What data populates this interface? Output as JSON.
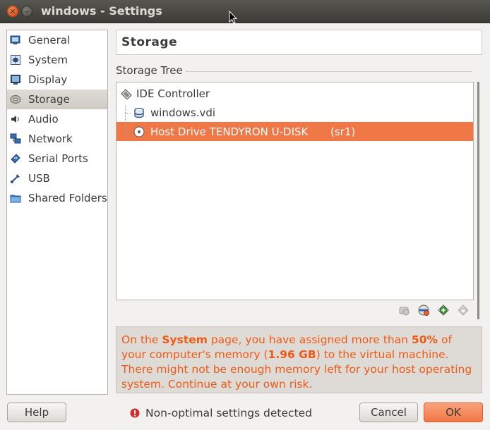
{
  "window": {
    "title": "windows - Settings"
  },
  "sidebar": {
    "items": [
      {
        "label": "General",
        "icon": "monitor-icon"
      },
      {
        "label": "System",
        "icon": "chip-icon"
      },
      {
        "label": "Display",
        "icon": "display-icon"
      },
      {
        "label": "Storage",
        "icon": "disk-icon",
        "active": true
      },
      {
        "label": "Audio",
        "icon": "speaker-icon"
      },
      {
        "label": "Network",
        "icon": "network-icon"
      },
      {
        "label": "Serial Ports",
        "icon": "serial-port-icon"
      },
      {
        "label": "USB",
        "icon": "usb-icon"
      },
      {
        "label": "Shared Folders",
        "icon": "folder-icon"
      }
    ]
  },
  "main": {
    "header": "Storage",
    "section_label": "Storage Tree",
    "tree": {
      "controller": "IDE Controller",
      "disk": "windows.vdi",
      "drive": "Host Drive TENDYRON U-DISK",
      "drive_slot": "(sr1)"
    },
    "warning": {
      "p1": "On the ",
      "b1": "System",
      "p2": " page, you have assigned more than ",
      "b2": "50%",
      "p3": " of your computer's memory (",
      "b3": "1.96 GB",
      "p4": ") to the virtual machine. There might not be enough memory left for your host operating system. Continue at your own risk."
    }
  },
  "footer": {
    "help": "Help",
    "status": "Non-optimal settings detected",
    "cancel": "Cancel",
    "ok": "OK"
  },
  "colors": {
    "accent": "#f07746",
    "warning_text": "#ee5a16"
  }
}
